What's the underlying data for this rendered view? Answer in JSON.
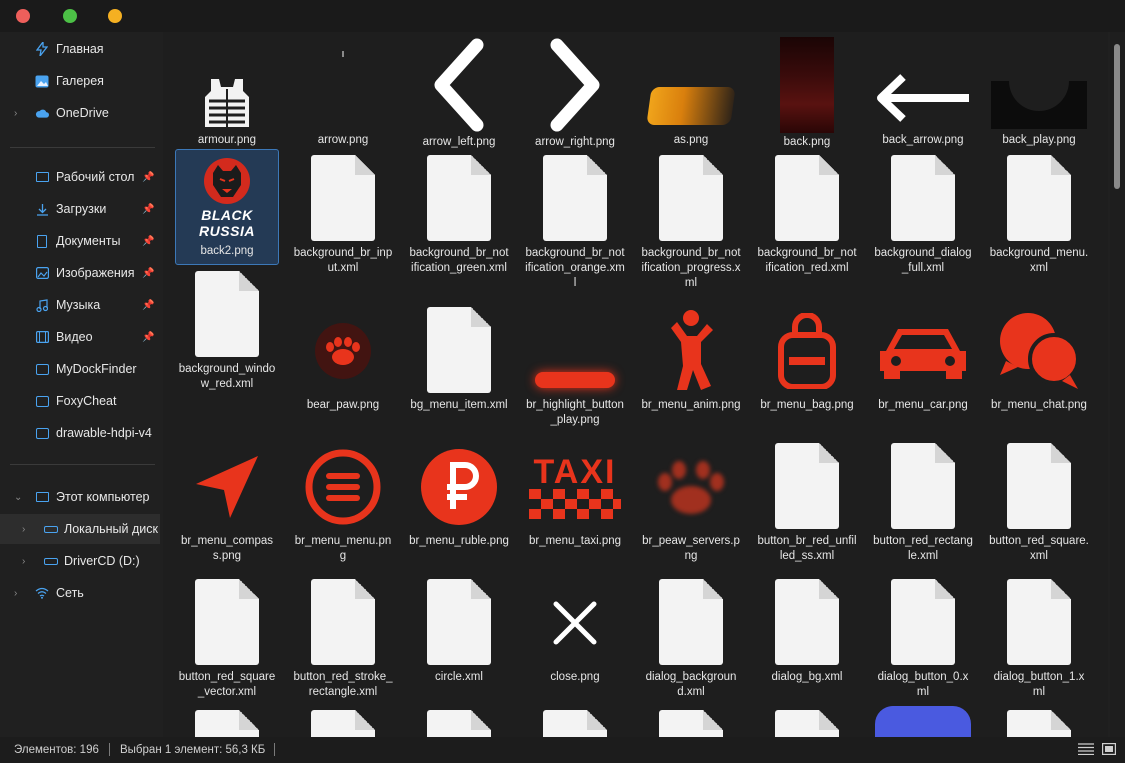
{
  "sidebar": {
    "items": [
      {
        "label": "Главная"
      },
      {
        "label": "Галерея"
      },
      {
        "label": "OneDrive"
      },
      {
        "label": "Рабочий стол"
      },
      {
        "label": "Загрузки"
      },
      {
        "label": "Документы"
      },
      {
        "label": "Изображения"
      },
      {
        "label": "Музыка"
      },
      {
        "label": "Видео"
      },
      {
        "label": "MyDockFinder"
      },
      {
        "label": "FoxyCheat"
      },
      {
        "label": "drawable-hdpi-v4"
      },
      {
        "label": "Этот компьютер"
      },
      {
        "label": "Локальный диск"
      },
      {
        "label": "DriverCD (D:)"
      },
      {
        "label": "Сеть"
      }
    ]
  },
  "files": [
    {
      "name": "armour.png"
    },
    {
      "name": "arrow.png"
    },
    {
      "name": "arrow_left.png"
    },
    {
      "name": "arrow_right.png"
    },
    {
      "name": "as.png"
    },
    {
      "name": "back.png"
    },
    {
      "name": "back_arrow.png"
    },
    {
      "name": "back_play.png"
    },
    {
      "name": "back2.png"
    },
    {
      "name": "background_br_input.xml"
    },
    {
      "name": "background_br_notification_green.xml"
    },
    {
      "name": "background_br_notification_orange.xml"
    },
    {
      "name": "background_br_notification_progress.xml"
    },
    {
      "name": "background_br_notification_red.xml"
    },
    {
      "name": "background_dialog_full.xml"
    },
    {
      "name": "background_menu.xml"
    },
    {
      "name": "background_window_red.xml"
    },
    {
      "name": "bear_paw.png"
    },
    {
      "name": "bg_menu_item.xml"
    },
    {
      "name": "br_highlight_button_play.png"
    },
    {
      "name": "br_menu_anim.png"
    },
    {
      "name": "br_menu_bag.png"
    },
    {
      "name": "br_menu_car.png"
    },
    {
      "name": "br_menu_chat.png"
    },
    {
      "name": "br_menu_compass.png"
    },
    {
      "name": "br_menu_menu.png"
    },
    {
      "name": "br_menu_ruble.png"
    },
    {
      "name": "br_menu_taxi.png"
    },
    {
      "name": "br_peaw_servers.png"
    },
    {
      "name": "button_br_red_unfilled_ss.xml"
    },
    {
      "name": "button_red_rectangle.xml"
    },
    {
      "name": "button_red_square.xml"
    },
    {
      "name": "button_red_square_vector.xml"
    },
    {
      "name": "button_red_stroke_rectangle.xml"
    },
    {
      "name": "circle.xml"
    },
    {
      "name": "close.png"
    },
    {
      "name": "dialog_background.xml"
    },
    {
      "name": "dialog_bg.xml"
    },
    {
      "name": "dialog_button_0.xml"
    },
    {
      "name": "dialog_button_1.xml"
    }
  ],
  "thumb_text": {
    "black": "BLACK",
    "russia": "RUSSIA",
    "taxi": "TAXI"
  },
  "status": {
    "count": "Элементов: 196",
    "selected": "Выбран 1 элемент: 56,3 КБ"
  },
  "colors": {
    "accent": "#4aa3f0",
    "brand_red": "#e8341c",
    "selection": "#243a55"
  }
}
